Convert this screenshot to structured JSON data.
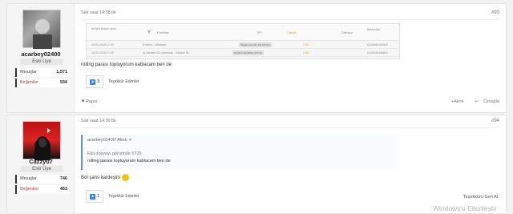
{
  "posts": [
    {
      "username": "acarbey02400",
      "user_title": "Eski Üye",
      "stats": [
        {
          "label": "Mesajlar",
          "value": "1,571"
        },
        {
          "label": "Beğeniler",
          "value": "934"
        }
      ],
      "date": "Salı saat 14:38'de",
      "number": "#93",
      "message": "rolling parası topluyorum kablacam ben de",
      "like_count": "3",
      "like_label": "Teşekkür Edenler",
      "report_label": "Rapor",
      "quote_label": "+Alıntı",
      "reply_label": "Cevapla",
      "embedded_screenshot": {
        "col1": "ak iyim lanıyor anun...",
        "col2": "Formlane",
        "col3": "TRY",
        "col4": "Ödendi",
        "col5": "Ödeniyor",
        "col6": "Bekleniyor",
        "rows": [
          {
            "date": "10-01-2019 17:00",
            "teams": "Everton - Leicester",
            "status": "Toplam Gol Alt / Üst 2.5 Üst",
            "odd": "1.89",
            "result": "KAZANILAMADI"
          },
          {
            "date": "10-01-2019 17:45",
            "teams": "Al-Nahdah SC (Umman) - Salalah SC",
            "status": "Toplam Gol Alt/Üst 3.5 Üst",
            "odd": "1.85",
            "result": "KAZANILAMADI"
          }
        ]
      }
    },
    {
      "username": "Cazzy07",
      "user_title": "Eski Üye",
      "stats": [
        {
          "label": "Mesajlar",
          "value": "746"
        },
        {
          "label": "Beğeniler",
          "value": "463"
        }
      ],
      "date": "Salı saat 14:39'de",
      "number": "#94",
      "quote_header": "acarbey02400' Alıntı",
      "quote_line1": "Ekli dosyayı görüntüle 6729",
      "quote_line2": "rolling parası topluyorum kablacam ben de",
      "message": "Bol şans kardeşim",
      "like_count": "1",
      "like_label": "Teşekkür Edenler",
      "thanks_back_label": "Teşekkürü Geri Al"
    }
  ],
  "watermark": "Windows'u Etkinleştir",
  "colors": {
    "accent": "#5b8fd9",
    "like_blue": "#3b82f6",
    "like_red": "#c04040"
  }
}
